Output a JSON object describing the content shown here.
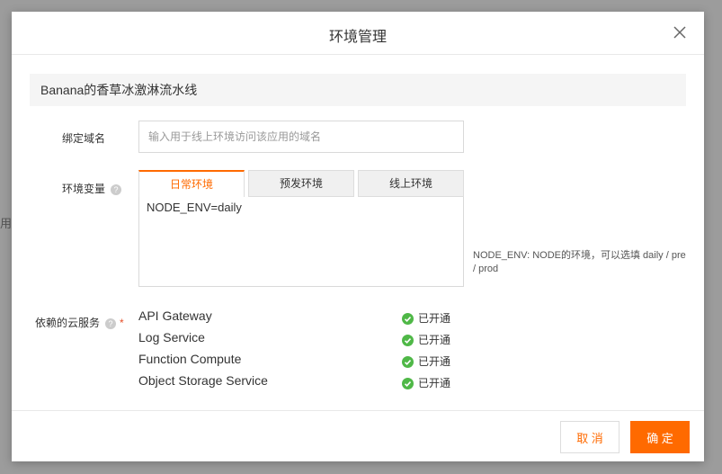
{
  "background": {
    "hint_text": "用"
  },
  "modal": {
    "title": "环境管理",
    "close_icon": "close-icon",
    "app_name": "Banana的香草冰激淋流水线"
  },
  "form": {
    "domain": {
      "label": "绑定域名",
      "placeholder": "输入用于线上环境访问该应用的域名",
      "value": ""
    },
    "env_vars": {
      "label": "环境变量",
      "tabs": [
        {
          "label": "日常环境",
          "active": true
        },
        {
          "label": "预发环境",
          "active": false
        },
        {
          "label": "线上环境",
          "active": false
        }
      ],
      "value": "NODE_ENV=daily",
      "help": "NODE_ENV: NODE的环境，可以选填 daily / pre / prod"
    },
    "services": {
      "label": "依赖的云服务",
      "required_mark": "*",
      "items": [
        {
          "name": "API Gateway",
          "status": "已开通"
        },
        {
          "name": "Log Service",
          "status": "已开通"
        },
        {
          "name": "Function Compute",
          "status": "已开通"
        },
        {
          "name": "Object Storage Service",
          "status": "已开通"
        }
      ]
    }
  },
  "footer": {
    "cancel_label": "取 消",
    "ok_label": "确 定"
  },
  "colors": {
    "accent": "#ff6a00",
    "success": "#4fb847",
    "required": "#e64f28"
  }
}
